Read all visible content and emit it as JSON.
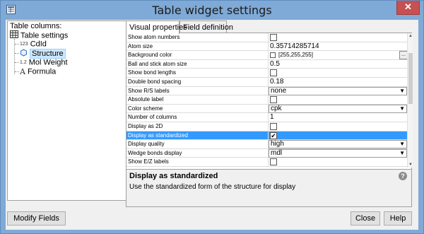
{
  "window": {
    "title": "Table widget settings",
    "close_glyph": "✕"
  },
  "left_panel": {
    "caption": "Table columns:",
    "tree": [
      {
        "label": "Table settings",
        "icon": "table-icon"
      },
      {
        "label": "CdId",
        "icon": "number-icon",
        "icon_text": "123"
      },
      {
        "label": "Structure",
        "icon": "structure-icon"
      },
      {
        "label": "Mol Weight",
        "icon": "decimal-icon",
        "icon_text": "1.2"
      },
      {
        "label": "Formula",
        "icon": "text-icon",
        "icon_text": "A"
      }
    ]
  },
  "tabs": [
    {
      "label": "Visual properties"
    },
    {
      "label": "Field definition"
    }
  ],
  "properties": [
    {
      "name": "Show atom numbers",
      "type": "check",
      "checked": false
    },
    {
      "name": "Atom size",
      "type": "text",
      "value": "0.35714285714"
    },
    {
      "name": "Background color",
      "type": "color",
      "value": "[255,255,255]",
      "button": "..."
    },
    {
      "name": "Ball and stick atom size",
      "type": "text",
      "value": "0.5"
    },
    {
      "name": "Show bond lengths",
      "type": "check",
      "checked": false
    },
    {
      "name": "Double bond spacing",
      "type": "text",
      "value": "0.18"
    },
    {
      "name": "Show R/S labels",
      "type": "combo",
      "value": "none"
    },
    {
      "name": "Absolute label",
      "type": "check",
      "checked": false
    },
    {
      "name": "Color scheme",
      "type": "combo",
      "value": "cpk"
    },
    {
      "name": "Number of columns",
      "type": "text",
      "value": "1"
    },
    {
      "name": "Display as 2D",
      "type": "check",
      "checked": false
    },
    {
      "name": "Display as standardized",
      "type": "check",
      "checked": true,
      "selected": true
    },
    {
      "name": "Display quality",
      "type": "combo",
      "value": "high"
    },
    {
      "name": "Wedge bonds display",
      "type": "combo",
      "value": "mdl"
    },
    {
      "name": "Show E/Z labels",
      "type": "check",
      "checked": false
    }
  ],
  "description": {
    "title": "Display as standardized",
    "text": "Use the standardized form of the structure for display",
    "help_glyph": "?"
  },
  "buttons": {
    "modify_fields": "Modify Fields",
    "close": "Close",
    "help": "Help"
  },
  "colors": {
    "titlebar": "#7fa9d6",
    "selection": "#3399ff",
    "close_button": "#c75050"
  }
}
